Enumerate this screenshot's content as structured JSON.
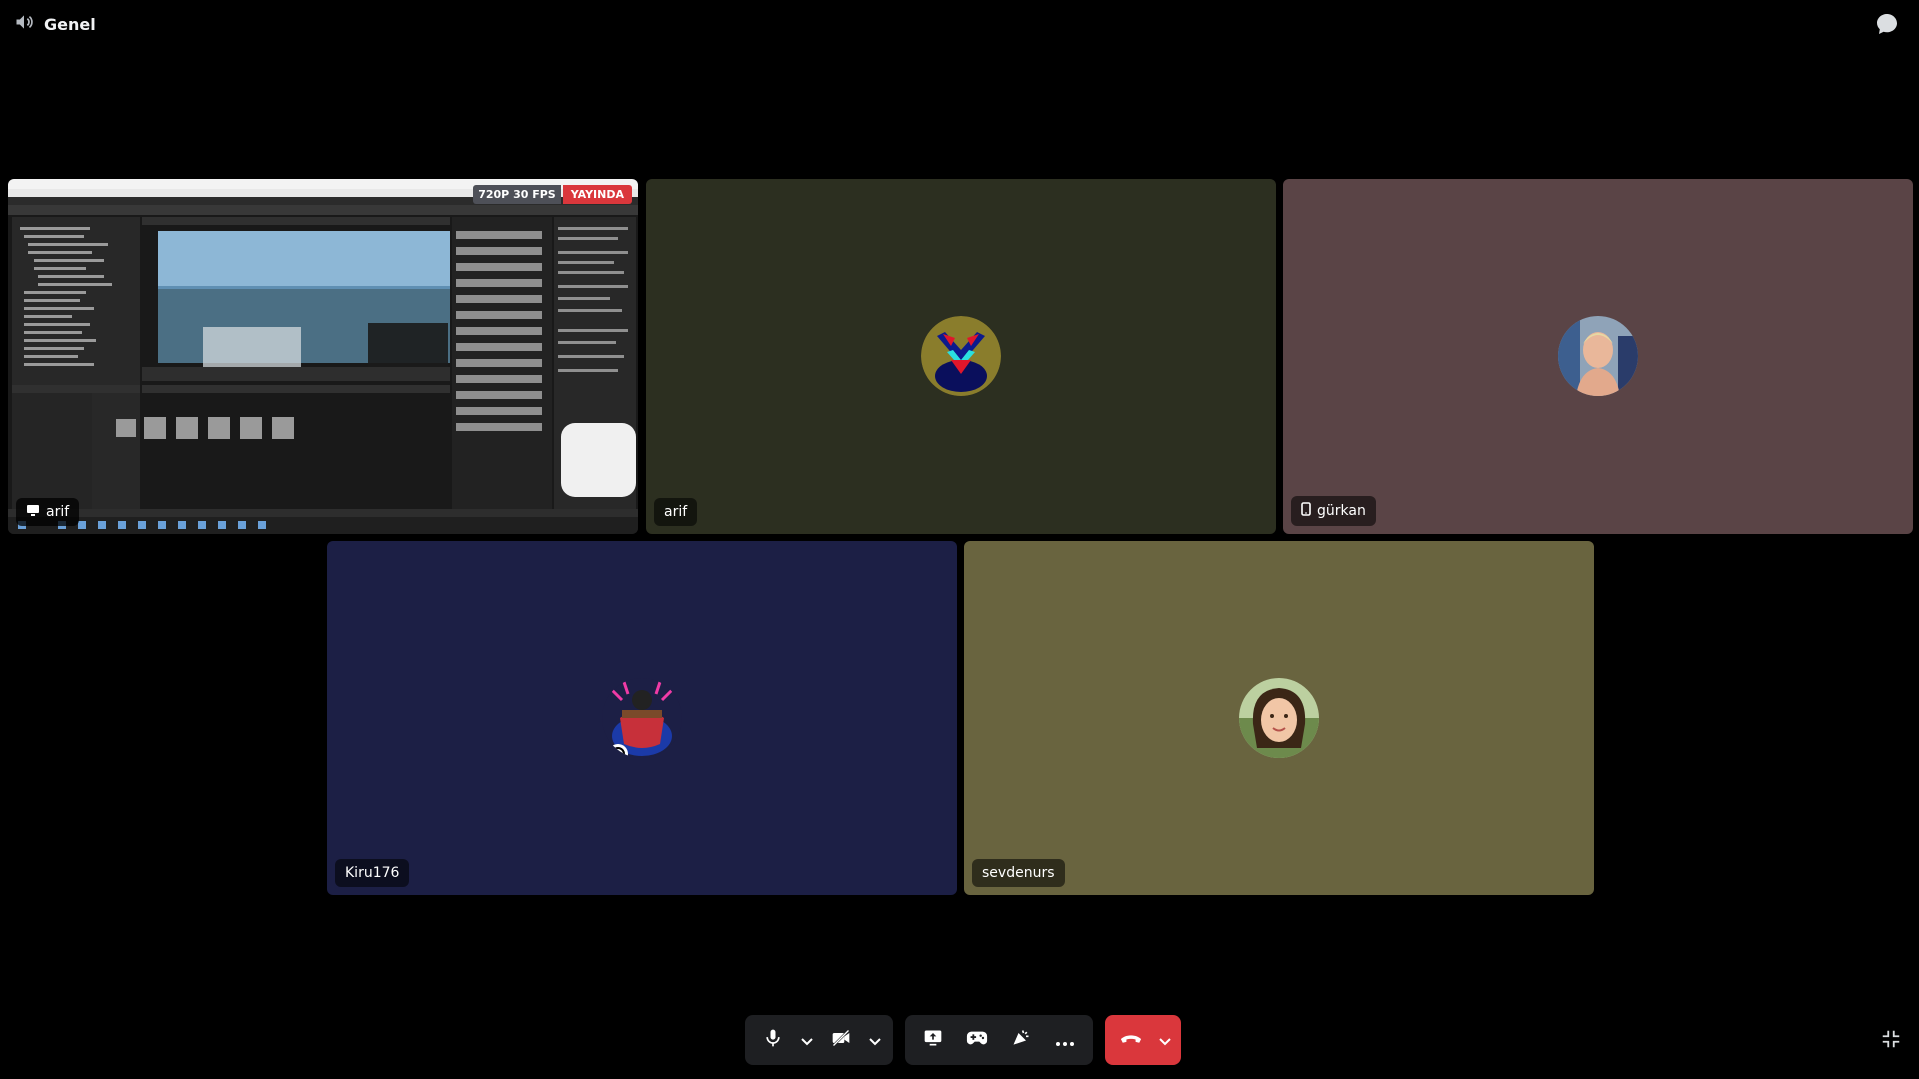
{
  "channel": {
    "name": "Genel",
    "icon": "speaker-icon"
  },
  "tiles": {
    "share": {
      "name": "arif",
      "quality": "720P 30 FPS",
      "live": "YAYINDA"
    },
    "arif": {
      "name": "arif",
      "bg": "#2c2f20"
    },
    "gurkan": {
      "name": "gürkan",
      "bg": "#5a4446",
      "device_icon": "mobile-icon"
    },
    "kiru": {
      "name": "Kiru176",
      "bg": "#1c1f45"
    },
    "sevdenurs": {
      "name": "sevdenurs",
      "bg": "#69643f"
    }
  },
  "controls": {
    "mic": "microphone-icon",
    "camera": "camera-off-icon",
    "screen": "screen-share-icon",
    "activity": "gamepad-icon",
    "soundboard": "soundboard-icon",
    "more": "more-icon",
    "hangup": "hang-up-icon",
    "hangup_color": "#da373c"
  }
}
